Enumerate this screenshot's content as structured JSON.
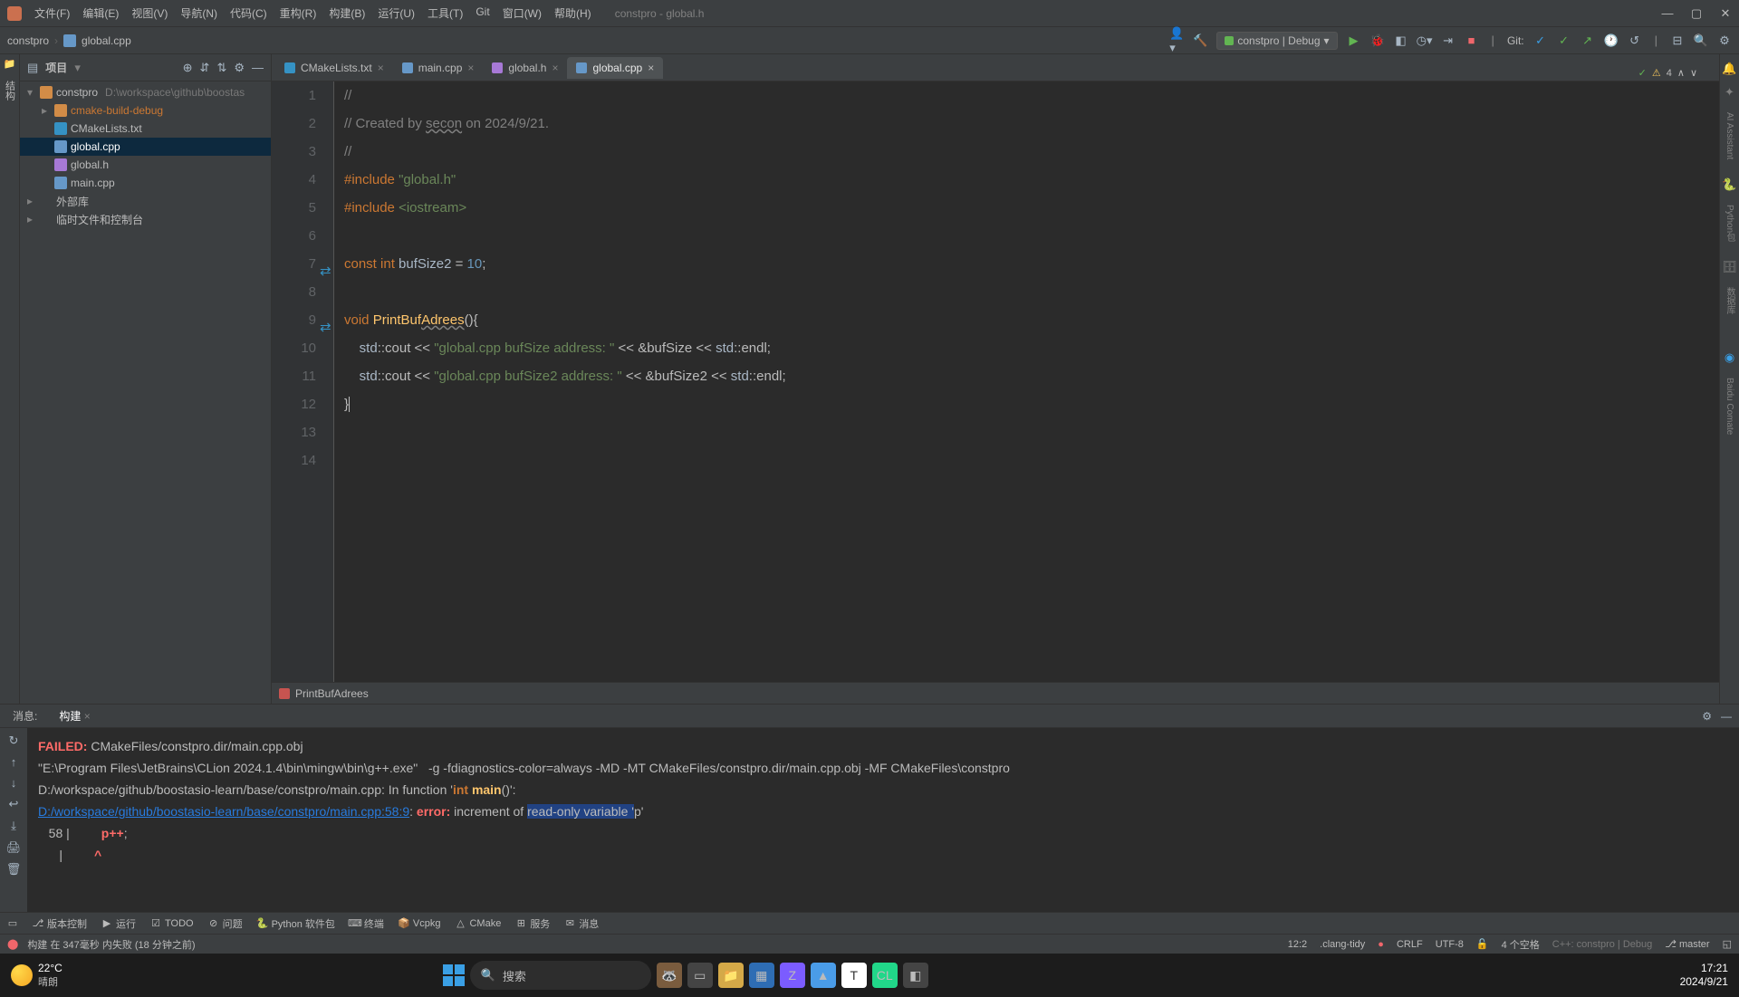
{
  "titlebar": {
    "menus": [
      "文件(F)",
      "编辑(E)",
      "视图(V)",
      "导航(N)",
      "代码(C)",
      "重构(R)",
      "构建(B)",
      "运行(U)",
      "工具(T)",
      "Git",
      "窗口(W)",
      "帮助(H)"
    ],
    "project_title": "constpro - global.h"
  },
  "breadcrumb": {
    "project": "constpro",
    "file": "global.cpp"
  },
  "run_config": {
    "label": "constpro | Debug"
  },
  "git_label": "Git:",
  "project_panel": {
    "title": "项目",
    "rows": [
      {
        "depth": 0,
        "type": "folder",
        "name": "constpro",
        "path": "D:\\workspace\\github\\boostas",
        "arrow": "▾"
      },
      {
        "depth": 1,
        "type": "folder",
        "name": "cmake-build-debug",
        "arrow": "▸",
        "warn": true
      },
      {
        "depth": 1,
        "type": "cmake",
        "name": "CMakeLists.txt"
      },
      {
        "depth": 1,
        "type": "cpp",
        "name": "global.cpp",
        "selected": true
      },
      {
        "depth": 1,
        "type": "h",
        "name": "global.h"
      },
      {
        "depth": 1,
        "type": "cpp",
        "name": "main.cpp"
      },
      {
        "depth": 0,
        "type": "lib",
        "name": "外部库",
        "arrow": "▸"
      },
      {
        "depth": 0,
        "type": "lib",
        "name": "临时文件和控制台",
        "arrow": "▸"
      }
    ]
  },
  "tabs": [
    {
      "name": "CMakeLists.txt",
      "type": "cmake"
    },
    {
      "name": "main.cpp",
      "type": "cpp"
    },
    {
      "name": "global.h",
      "type": "h"
    },
    {
      "name": "global.cpp",
      "type": "cpp",
      "active": true
    }
  ],
  "code": {
    "lines": [
      {
        "n": 1,
        "html": "<span class='cmt'>//</span>"
      },
      {
        "n": 2,
        "html": "<span class='cmt'>// Created by <span class='squiggle'>secon</span> on 2024/9/21.</span>"
      },
      {
        "n": 3,
        "html": "<span class='cmt'>//</span>"
      },
      {
        "n": 4,
        "html": "<span class='inc'>#include</span> <span class='incstr'>\"global.h\"</span>"
      },
      {
        "n": 5,
        "html": "<span class='inc'>#include</span> <span class='incstr'>&lt;iostream&gt;</span>"
      },
      {
        "n": 6,
        "html": ""
      },
      {
        "n": 7,
        "html": "<span class='kw'>const</span> <span class='kw'>int</span> <span class='ident'>bufSize2</span> = <span class='num'>10</span>;"
      },
      {
        "n": 8,
        "html": ""
      },
      {
        "n": 9,
        "html": "<span class='kw'>void</span> <span class='fn'>PrintBuf<span class='squiggle'>Adrees</span></span>(){"
      },
      {
        "n": 10,
        "html": "    <span class='ns'>std</span>::cout &lt;&lt; <span class='str'>\"global.cpp bufSize address: \"</span> &lt;&lt; &amp;bufSize &lt;&lt; <span class='ns'>std</span>::endl;"
      },
      {
        "n": 11,
        "html": "    <span class='ns'>std</span>::cout &lt;&lt; <span class='str'>\"global.cpp bufSize2 address: \"</span> &lt;&lt; &amp;bufSize2 &lt;&lt; <span class='ns'>std</span>::endl;"
      },
      {
        "n": 12,
        "html": "}<span class='caret'></span>"
      },
      {
        "n": 13,
        "html": ""
      },
      {
        "n": 14,
        "html": ""
      }
    ]
  },
  "editor_footer": {
    "fn": "PrintBufAdrees"
  },
  "inspections": {
    "warn_count": "4"
  },
  "build": {
    "tabs": {
      "messages": "消息:",
      "build": "构建"
    },
    "output": [
      {
        "html": "<span class='fail'>FAILED:</span> CMakeFiles/constpro.dir/main.cpp.obj"
      },
      {
        "html": "\"E:\\Program Files\\JetBrains\\CLion 2024.1.4\\bin\\mingw\\bin\\g++.exe\"   -g -fdiagnostics-color=always -MD -MT CMakeFiles/constpro.dir/main.cpp.obj -MF CMakeFiles\\constpro"
      },
      {
        "html": "D:/workspace/github/boostasio-learn/base/constpro/main.cpp: In function '<span class='btype'>int</span> <span class='bfn'>main</span>()':"
      },
      {
        "html": "<span class='link'>D:/workspace/github/boostasio-learn/base/constpro/main.cpp:58:9</span>: <span class='err'>error:</span> increment of <span class='hl'>read-only variable '</span>p'"
      },
      {
        "html": "   58 |         <span class='err'>p++</span>;"
      },
      {
        "html": "      |         <span class='err'>^</span>"
      }
    ]
  },
  "tool_strip": {
    "items": [
      "版本控制",
      "运行",
      "TODO",
      "问题",
      "Python 软件包",
      "终端",
      "Vcpkg",
      "CMake",
      "服务",
      "消息"
    ]
  },
  "status_bar": {
    "left_icon": "!",
    "left": "构建 在 347毫秒 内失败 (18 分钟之前)",
    "pos": "12:2",
    "inspector": ".clang-tidy",
    "le": "CRLF",
    "enc": "UTF-8",
    "indent": "4 个空格",
    "ctx": "C++: constpro | Debug",
    "branch": "master"
  },
  "taskbar": {
    "temp": "22°C",
    "desc": "晴朗",
    "search": "搜索",
    "time": "17:21",
    "date": "2024/9/21"
  }
}
